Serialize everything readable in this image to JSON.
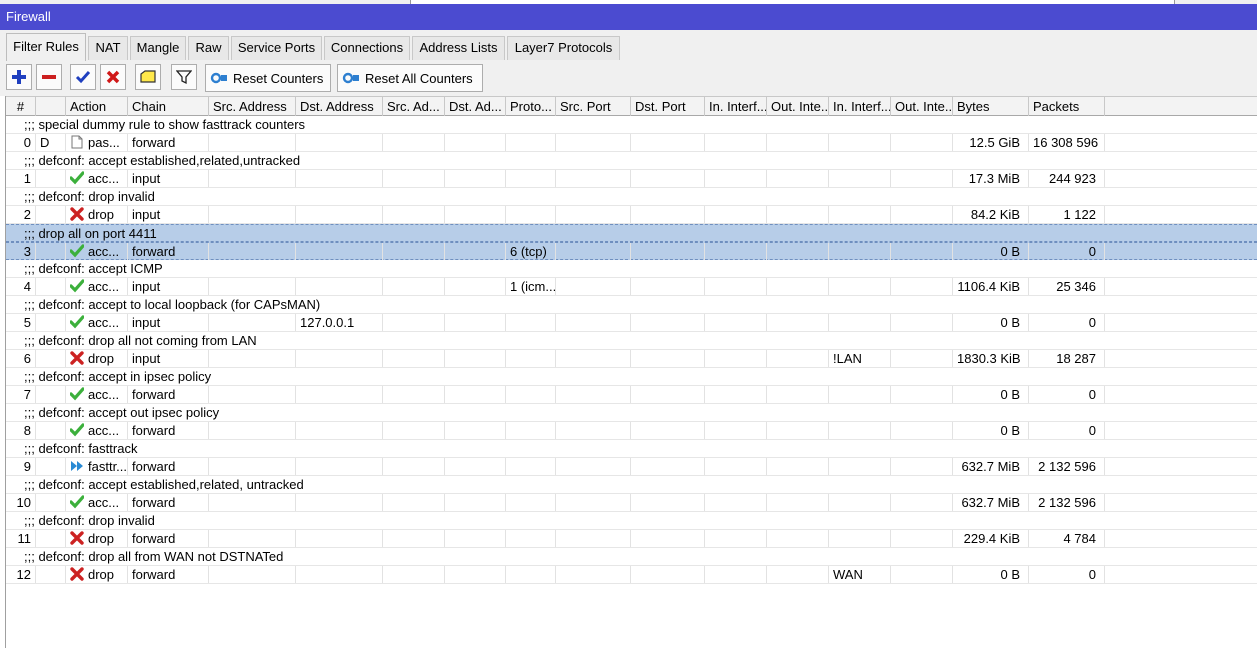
{
  "window": {
    "title": "Firewall"
  },
  "tabs": [
    {
      "label": "Filter Rules",
      "active": true
    },
    {
      "label": "NAT"
    },
    {
      "label": "Mangle"
    },
    {
      "label": "Raw"
    },
    {
      "label": "Service Ports"
    },
    {
      "label": "Connections"
    },
    {
      "label": "Address Lists"
    },
    {
      "label": "Layer7 Protocols"
    }
  ],
  "toolbar": {
    "add_icon": "plus-icon",
    "remove_icon": "minus-icon",
    "enable_icon": "check-icon",
    "disable_icon": "cross-icon",
    "comment_icon": "note-icon",
    "filter_icon": "filter-icon",
    "reset_counters": "Reset Counters",
    "reset_all_counters": "Reset All Counters"
  },
  "columns": [
    "#",
    "",
    "Action",
    "Chain",
    "Src. Address",
    "Dst. Address",
    "Src. Ad...",
    "Dst. Ad...",
    "Proto...",
    "Src. Port",
    "Dst. Port",
    "In. Interf...",
    "Out. Inte...",
    "In. Interf...",
    "Out. Inte...",
    "Bytes",
    "Packets"
  ],
  "colors": {
    "titlebar": "#4b4bd0",
    "selected_row": "#b7cde8",
    "accept": "#3cb03c",
    "drop": "#cc2222",
    "fasttrack": "#2a8ad4"
  },
  "rows": [
    {
      "comment": ";;; special dummy rule to show fasttrack counters",
      "num": "0",
      "flag": "D",
      "action_icon": "passthrough-icon",
      "action": "pas...",
      "chain": "forward",
      "bytes": "12.5 GiB",
      "packets": "16 308 596"
    },
    {
      "comment": ";;; defconf: accept established,related,untracked",
      "num": "1",
      "action_icon": "accept-icon",
      "action": "acc...",
      "chain": "input",
      "bytes": "17.3 MiB",
      "packets": "244 923"
    },
    {
      "comment": ";;; defconf: drop invalid",
      "num": "2",
      "action_icon": "drop-icon",
      "action": "drop",
      "chain": "input",
      "bytes": "84.2 KiB",
      "packets": "1 122"
    },
    {
      "comment": ";;; drop all on port 4411",
      "num": "3",
      "action_icon": "accept-icon",
      "action": "acc...",
      "chain": "forward",
      "proto": "6 (tcp)",
      "bytes": "0 B",
      "packets": "0",
      "selected": true
    },
    {
      "comment": ";;; defconf: accept ICMP",
      "num": "4",
      "action_icon": "accept-icon",
      "action": "acc...",
      "chain": "input",
      "proto": "1 (icm...",
      "bytes": "1106.4 KiB",
      "packets": "25 346"
    },
    {
      "comment": ";;; defconf: accept to local loopback (for CAPsMAN)",
      "num": "5",
      "action_icon": "accept-icon",
      "action": "acc...",
      "chain": "input",
      "dst": "127.0.0.1",
      "bytes": "0 B",
      "packets": "0"
    },
    {
      "comment": ";;; defconf: drop all not coming from LAN",
      "num": "6",
      "action_icon": "drop-icon",
      "action": "drop",
      "chain": "input",
      "inlist": "!LAN",
      "bytes": "1830.3 KiB",
      "packets": "18 287"
    },
    {
      "comment": ";;; defconf: accept in ipsec policy",
      "num": "7",
      "action_icon": "accept-icon",
      "action": "acc...",
      "chain": "forward",
      "bytes": "0 B",
      "packets": "0"
    },
    {
      "comment": ";;; defconf: accept out ipsec policy",
      "num": "8",
      "action_icon": "accept-icon",
      "action": "acc...",
      "chain": "forward",
      "bytes": "0 B",
      "packets": "0"
    },
    {
      "comment": ";;; defconf: fasttrack",
      "num": "9",
      "action_icon": "fasttrack-icon",
      "action": "fasttr...",
      "chain": "forward",
      "bytes": "632.7 MiB",
      "packets": "2 132 596"
    },
    {
      "comment": ";;; defconf: accept established,related, untracked",
      "num": "10",
      "action_icon": "accept-icon",
      "action": "acc...",
      "chain": "forward",
      "bytes": "632.7 MiB",
      "packets": "2 132 596"
    },
    {
      "comment": ";;; defconf: drop invalid",
      "num": "11",
      "action_icon": "drop-icon",
      "action": "drop",
      "chain": "forward",
      "bytes": "229.4 KiB",
      "packets": "4 784"
    },
    {
      "comment": ";;; defconf: drop all from WAN not DSTNATed",
      "num": "12",
      "action_icon": "drop-icon",
      "action": "drop",
      "chain": "forward",
      "inlist": "WAN",
      "bytes": "0 B",
      "packets": "0"
    }
  ]
}
